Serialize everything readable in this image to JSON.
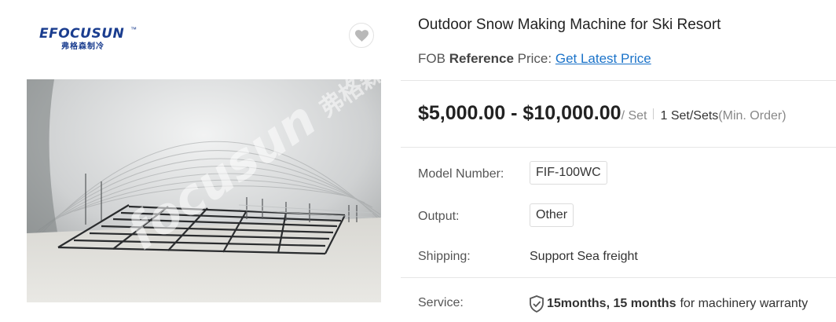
{
  "brand": {
    "logo_word": "EFOCUSUN",
    "logo_tm": "™",
    "logo_cn": "弗格森制冷"
  },
  "favorite": {
    "icon": "heart-icon"
  },
  "photo": {
    "watermark_word": "focusun",
    "watermark_cn": "弗格森"
  },
  "product": {
    "title": "Outdoor Snow Making Machine for Ski Resort",
    "ref_prefix": "FOB",
    "ref_bold": "Reference",
    "ref_suffix": "Price:",
    "ref_link": "Get Latest Price",
    "price_range": "$5,000.00 - $10,000.00",
    "price_unit": "/ Set",
    "moq": "1 Set/Sets",
    "moq_note": "(Min. Order)"
  },
  "specs": {
    "model_label": "Model Number:",
    "model_value": "FIF-100WC",
    "output_label": "Output:",
    "output_value": "Other",
    "shipping_label": "Shipping:",
    "shipping_value": "Support Sea freight",
    "service_label": "Service:",
    "service_bold": "15months, 15 months",
    "service_rest": "for machinery warranty"
  }
}
